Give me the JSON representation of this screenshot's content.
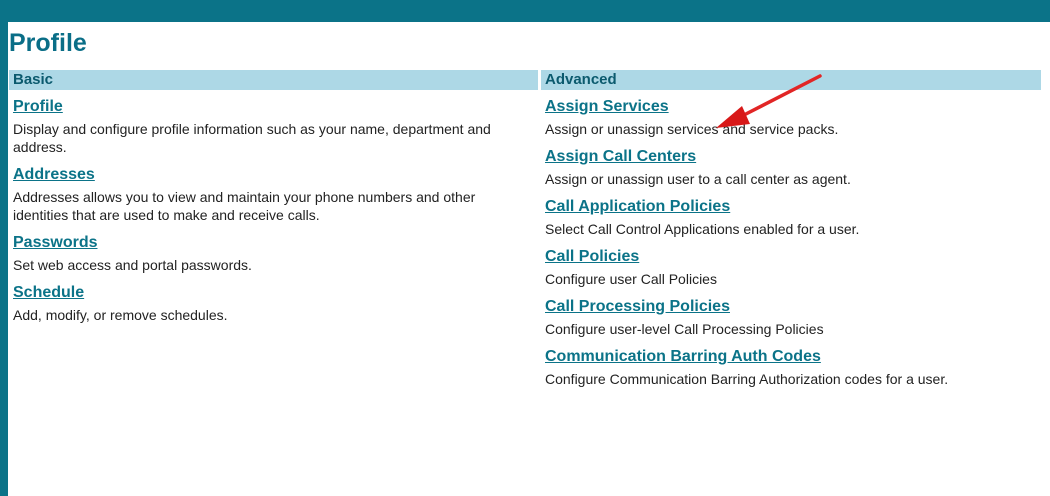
{
  "page": {
    "title": "Profile"
  },
  "sections": {
    "basic": {
      "header": "Basic",
      "items": [
        {
          "label": "Profile",
          "desc": "Display and configure profile information such as your name, department and address."
        },
        {
          "label": "Addresses",
          "desc": "Addresses allows you to view and maintain your phone numbers and other identities that are used to make and receive calls."
        },
        {
          "label": "Passwords",
          "desc": "Set web access and portal passwords."
        },
        {
          "label": "Schedule",
          "desc": "Add, modify, or remove schedules."
        }
      ]
    },
    "advanced": {
      "header": "Advanced",
      "items": [
        {
          "label": "Assign Services",
          "desc": "Assign or unassign services and service packs."
        },
        {
          "label": "Assign Call Centers",
          "desc": "Assign or unassign user to a call center as agent."
        },
        {
          "label": "Call Application Policies",
          "desc": "Select Call Control Applications enabled for a user."
        },
        {
          "label": "Call Policies",
          "desc": "Configure user Call Policies"
        },
        {
          "label": "Call Processing Policies",
          "desc": "Configure user-level Call Processing Policies"
        },
        {
          "label": "Communication Barring Auth Codes",
          "desc": "Configure Communication Barring Authorization codes for a user."
        }
      ]
    }
  },
  "colors": {
    "brand": "#0b7388",
    "section_header_bg": "#add8e6",
    "annotation_arrow": "#e02020"
  },
  "annotations": {
    "arrow_icon": "red-pointer-arrow-icon"
  }
}
